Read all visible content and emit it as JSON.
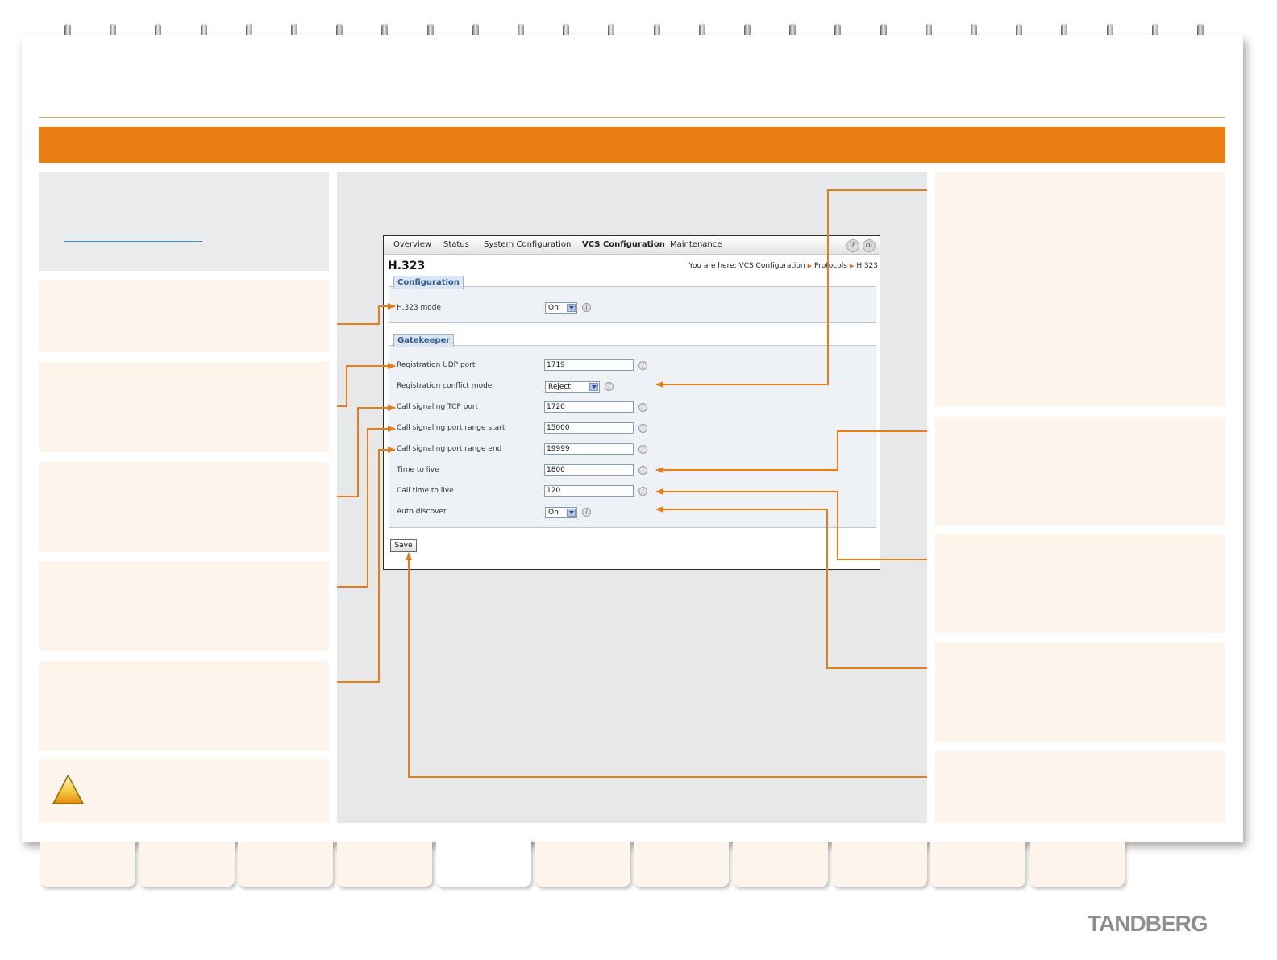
{
  "nav": {
    "items": [
      "Overview",
      "Status",
      "System Configuration",
      "VCS Configuration",
      "Maintenance"
    ],
    "active": "VCS Configuration"
  },
  "page": {
    "title": "H.323",
    "breadcrumb_prefix": "You are here:",
    "breadcrumb": [
      "VCS Configuration",
      "Protocols",
      "H.323"
    ]
  },
  "configuration": {
    "section_label": "Configuration",
    "h323_mode": {
      "label": "H.323 mode",
      "value": "On"
    }
  },
  "gatekeeper": {
    "section_label": "Gatekeeper",
    "fields": [
      {
        "label": "Registration UDP port",
        "value": "1719",
        "type": "text"
      },
      {
        "label": "Registration conflict mode",
        "value": "Reject",
        "type": "select"
      },
      {
        "label": "Call signaling TCP port",
        "value": "1720",
        "type": "text"
      },
      {
        "label": "Call signaling port range start",
        "value": "15000",
        "type": "text"
      },
      {
        "label": "Call signaling port range end",
        "value": "19999",
        "type": "text"
      },
      {
        "label": "Time to live",
        "value": "1800",
        "type": "text"
      },
      {
        "label": "Call time to live",
        "value": "120",
        "type": "text"
      },
      {
        "label": "Auto discover",
        "value": "On",
        "type": "select"
      }
    ]
  },
  "save_label": "Save",
  "help_icon": "?",
  "logout_icon": "O-",
  "info_glyph": "i",
  "brand": "TANDBERG",
  "colors": {
    "accent": "#ea7c14",
    "panel": "#fdf4ec",
    "center": "#e7e8ea"
  },
  "icons": [
    "warning-triangle-icon",
    "help-icon",
    "logout-icon",
    "info-icon"
  ]
}
